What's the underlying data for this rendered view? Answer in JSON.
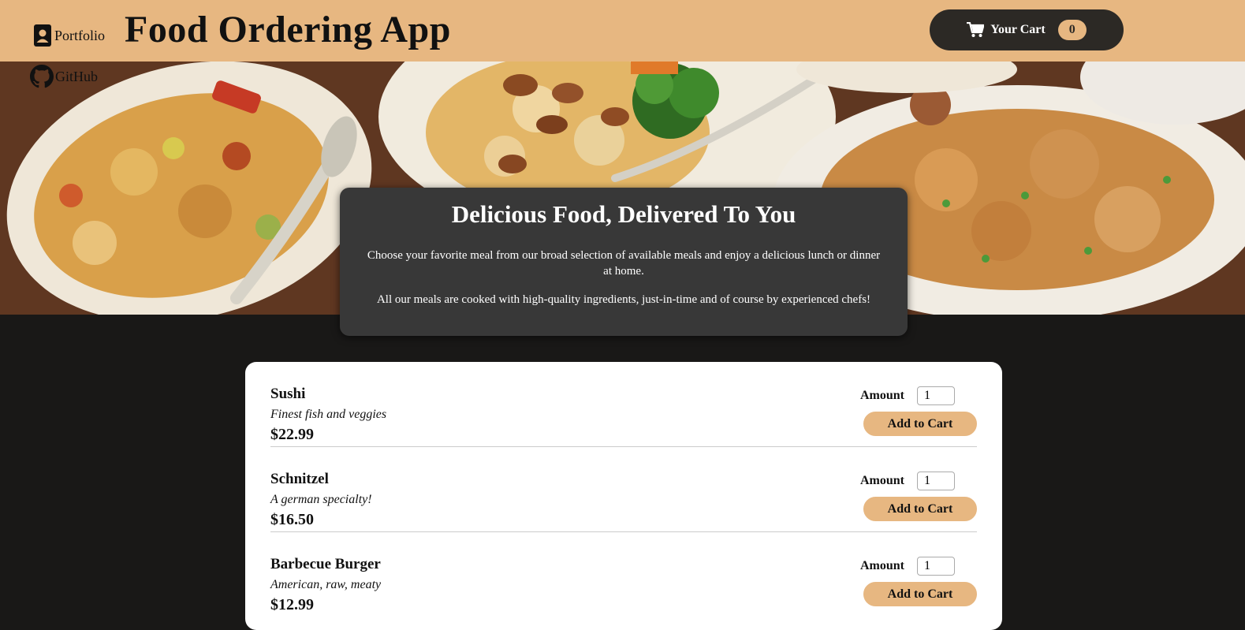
{
  "header": {
    "portfolio_label": "Portfolio",
    "github_label": "GitHub",
    "title": "Food Ordering App",
    "cart": {
      "label": "Your Cart",
      "count": "0"
    }
  },
  "summary": {
    "heading": "Delicious Food, Delivered To You",
    "paragraph1": "Choose your favorite meal from our broad selection of available meals and enjoy a delicious lunch or dinner at home.",
    "paragraph2": "All our meals are cooked with high-quality ingredients, just-in-time and of course by experienced chefs!"
  },
  "meals": [
    {
      "name": "Sushi",
      "description": "Finest fish and veggies",
      "price": "$22.99",
      "amount_label": "Amount",
      "amount": "1",
      "button": "Add to Cart"
    },
    {
      "name": "Schnitzel",
      "description": "A german specialty!",
      "price": "$16.50",
      "amount_label": "Amount",
      "amount": "1",
      "button": "Add to Cart"
    },
    {
      "name": "Barbecue Burger",
      "description": "American, raw, meaty",
      "price": "$12.99",
      "amount_label": "Amount",
      "amount": "1",
      "button": "Add to Cart"
    }
  ],
  "colors": {
    "accent": "#e7b781",
    "dark": "#2c2925",
    "background": "#191817",
    "summary_bg": "#383838"
  },
  "icons": {
    "portfolio": "contact-card-icon",
    "github": "github-icon",
    "cart": "cart-icon"
  }
}
